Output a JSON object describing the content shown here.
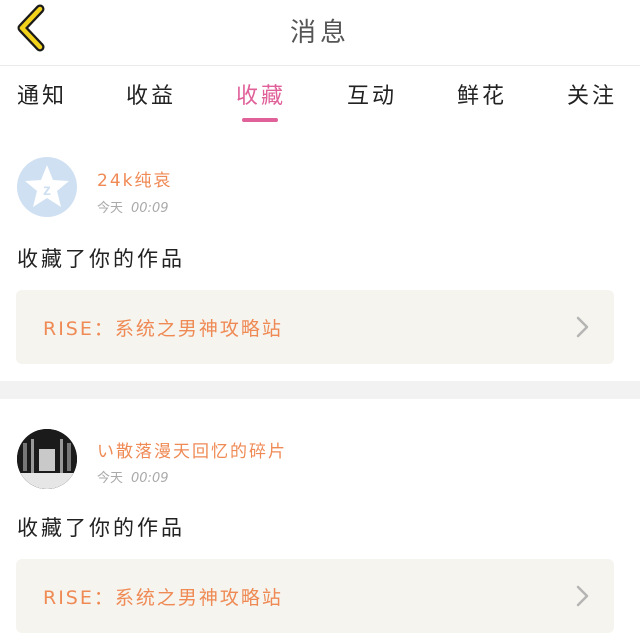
{
  "header": {
    "title": "消息",
    "back_icon": "chevron-left-icon"
  },
  "tabs": [
    {
      "label": "通知"
    },
    {
      "label": "收益"
    },
    {
      "label": "收藏",
      "active": true
    },
    {
      "label": "互动"
    },
    {
      "label": "鲜花"
    },
    {
      "label": "关注"
    }
  ],
  "accent": "#e0609a",
  "name_color": "#ef8a55",
  "messages": [
    {
      "username": "24k纯哀",
      "day": "今天",
      "time": "00:09",
      "action": "收藏了你的作品",
      "work_title": "RISE：系统之男神攻略站"
    },
    {
      "username": "い散落漫天回忆的碎片",
      "day": "今天",
      "time": "00:09",
      "action": "收藏了你的作品",
      "work_title": "RISE：系统之男神攻略站"
    }
  ]
}
